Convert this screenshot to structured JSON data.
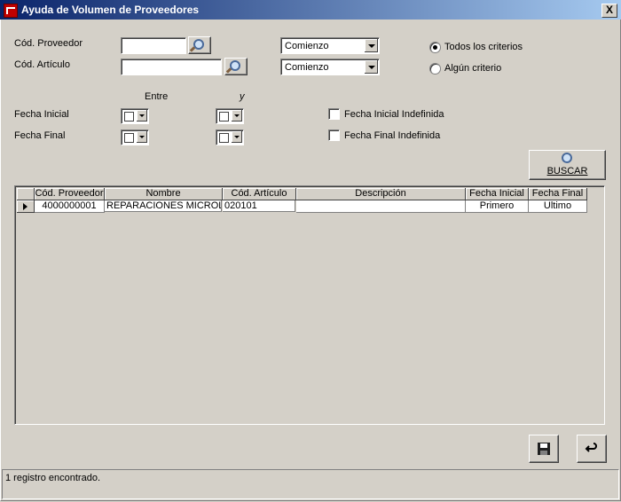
{
  "window": {
    "title": "Ayuda de Volumen de Proveedores",
    "close_label": "X"
  },
  "form": {
    "cod_proveedor": {
      "label": "Cód. Proveedor",
      "value": "",
      "match": "Comienzo"
    },
    "cod_articulo": {
      "label": "Cód. Artículo",
      "value": "",
      "match": "Comienzo"
    },
    "criteria": {
      "all": "Todos los criterios",
      "any": "Algún criterio",
      "selected": "all"
    },
    "entre_label": "Entre",
    "y_label": "y",
    "fecha_inicial": {
      "label": "Fecha Inicial",
      "indef_label": "Fecha Inicial Indefinida",
      "indef_checked": false
    },
    "fecha_final": {
      "label": "Fecha Final",
      "indef_label": "Fecha Final Indefinida",
      "indef_checked": false
    },
    "buscar_label": "BUSCAR"
  },
  "table": {
    "columns": [
      "Cód. Proveedor",
      "Nombre",
      "Cód. Artículo",
      "Descripción",
      "Fecha Inicial",
      "Fecha Final"
    ],
    "rows": [
      [
        "4000000001",
        "REPARACIONES MICROL",
        "020101",
        "",
        "Primero",
        "Ultimo"
      ]
    ]
  },
  "status": {
    "text": "1 registro encontrado."
  }
}
